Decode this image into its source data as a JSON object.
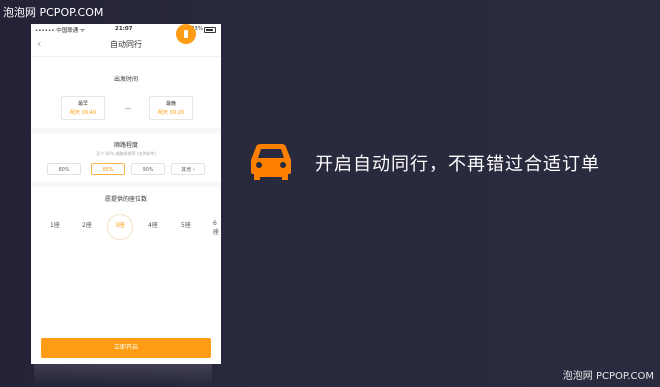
{
  "watermark": {
    "top": "泡泡网 PCPOP.COM",
    "bottom": "泡泡网 PCPOP.COM"
  },
  "status_bar": {
    "carrier": "•••••• 中国联通 ᯤ",
    "time": "21:07",
    "battery": "83%"
  },
  "nav": {
    "title": "自动同行",
    "back_icon": "chevron-left-icon"
  },
  "departure": {
    "section_title": "出发时间",
    "earliest_label": "最早",
    "earliest_value": "明天 09:40",
    "latest_label": "最晚",
    "latest_value": "明天 09:20"
  },
  "route_match": {
    "section_title": "顺路程度",
    "note": "至少 60% 顺路即推荐 (仅供参考)",
    "options": [
      "80%",
      "85%",
      "90%",
      "其他 ›"
    ],
    "selected": "85%"
  },
  "seats": {
    "section_title": "愿提供的座位数",
    "options": [
      "1座",
      "2座",
      "3座",
      "4座",
      "5座",
      "6座"
    ],
    "selected": "3座"
  },
  "start_button": {
    "label": "立即开启"
  },
  "headline": {
    "text": "开启自动同行，不再错过合适订单",
    "icon": "car-icon"
  },
  "colors": {
    "accent": "#ff9c13",
    "background": "#2a2a3e",
    "headline": "#ffffff"
  }
}
